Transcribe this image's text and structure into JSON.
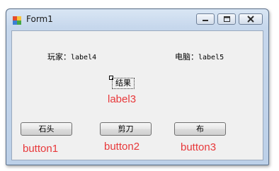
{
  "window": {
    "title": "Form1",
    "controls": [
      "minimize-icon",
      "maximize-icon",
      "close-icon"
    ]
  },
  "labels": {
    "player_prefix": "玩家：",
    "player_value": "label4",
    "computer_prefix": "电脑：",
    "computer_value": "label5",
    "result": "结果"
  },
  "buttons": [
    {
      "label": "石头"
    },
    {
      "label": "剪刀"
    },
    {
      "label": "布"
    }
  ],
  "annotations": {
    "label3": "label3",
    "button1": "button1",
    "button2": "button2",
    "button3": "button3"
  },
  "colors": {
    "annotation": "#e8383a",
    "window_frame": "#bcd0e8",
    "client_bg": "#f0f0f0"
  }
}
